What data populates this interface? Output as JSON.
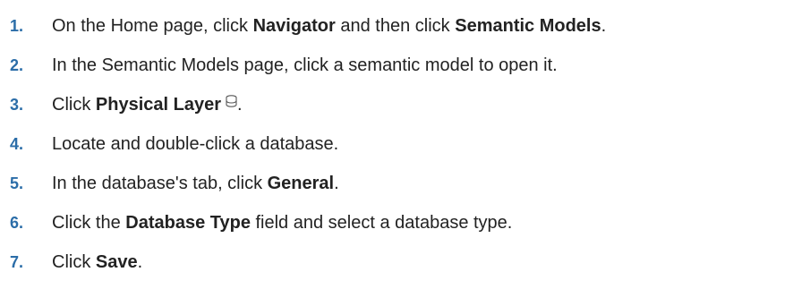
{
  "accent_color": "#2b6da8",
  "steps": [
    {
      "number": "1.",
      "parts": [
        "On the Home page, click ",
        "Navigator",
        " and then click ",
        "Semantic Models",
        "."
      ]
    },
    {
      "number": "2.",
      "parts": [
        "In the Semantic Models page, click a semantic model to open it."
      ]
    },
    {
      "number": "3.",
      "parts": [
        "Click ",
        "Physical Layer",
        "."
      ],
      "icon": "database-icon"
    },
    {
      "number": "4.",
      "parts": [
        "Locate and double-click a database."
      ]
    },
    {
      "number": "5.",
      "parts": [
        "In the database's tab, click ",
        "General",
        "."
      ]
    },
    {
      "number": "6.",
      "parts": [
        "Click the ",
        "Database Type",
        " field and select a database type."
      ]
    },
    {
      "number": "7.",
      "parts": [
        "Click ",
        "Save",
        "."
      ]
    }
  ]
}
